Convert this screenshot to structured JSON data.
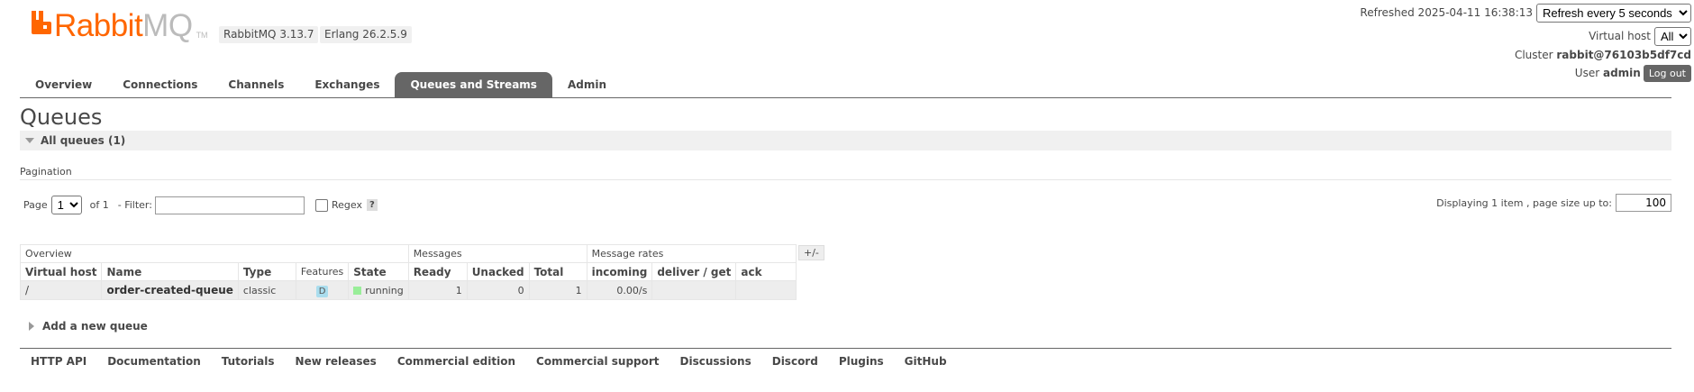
{
  "header": {
    "logo_text_1": "Rabbit",
    "logo_text_2": "MQ",
    "logo_tm": "TM",
    "rabbitmq_version": "RabbitMQ 3.13.7",
    "erlang_version": "Erlang 26.2.5.9",
    "refreshed_label": "Refreshed 2025-04-11 16:38:13",
    "refresh_select": "Refresh every 5 seconds",
    "virtual_host_label": "Virtual host",
    "virtual_host_value": "All",
    "cluster_label": "Cluster",
    "cluster_value": "rabbit@76103b5df7cd",
    "user_label": "User",
    "user_value": "admin",
    "logout_label": "Log out"
  },
  "tabs": [
    {
      "label": "Overview",
      "active": false
    },
    {
      "label": "Connections",
      "active": false
    },
    {
      "label": "Channels",
      "active": false
    },
    {
      "label": "Exchanges",
      "active": false
    },
    {
      "label": "Queues and Streams",
      "active": true
    },
    {
      "label": "Admin",
      "active": false
    }
  ],
  "main": {
    "title": "Queues",
    "section_label": "All queues (1)",
    "pagination_label": "Pagination",
    "page_label": "Page",
    "page_value": "1",
    "of_label": "of 1",
    "filter_label": "- Filter:",
    "filter_value": "",
    "regex_label": "Regex",
    "help_label": "?",
    "displaying_label": "Displaying 1 item , page size up to:",
    "page_size_value": "100",
    "plus_minus_label": "+/-",
    "add_queue_label": "Add a new queue"
  },
  "table": {
    "groups": [
      "Overview",
      "Messages",
      "Message rates"
    ],
    "columns": [
      "Virtual host",
      "Name",
      "Type",
      "Features",
      "State",
      "Ready",
      "Unacked",
      "Total",
      "incoming",
      "deliver / get",
      "ack"
    ],
    "rows": [
      {
        "virtual_host": "/",
        "name": "order-created-queue",
        "type": "classic",
        "features": "D",
        "state": "running",
        "ready": "1",
        "unacked": "0",
        "total": "1",
        "incoming": "0.00/s",
        "deliver_get": "",
        "ack": ""
      }
    ]
  },
  "footer": {
    "links": [
      "HTTP API",
      "Documentation",
      "Tutorials",
      "New releases",
      "Commercial edition",
      "Commercial support",
      "Discussions",
      "Discord",
      "Plugins",
      "GitHub"
    ]
  },
  "colors": {
    "brand_orange": "#ff6600",
    "tab_active": "#666666",
    "running_green": "#99ee99",
    "durable_badge": "#aaddee"
  }
}
